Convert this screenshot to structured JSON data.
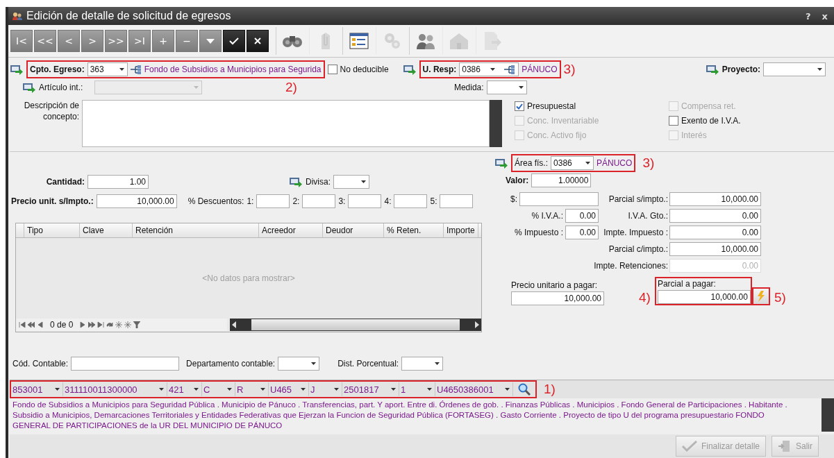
{
  "window": {
    "title": "Edición de detalle de solicitud de egresos",
    "help_button": "?",
    "close_button": "x"
  },
  "toolbar": [
    {
      "kind": "glyph",
      "label": "I<",
      "disabled": false
    },
    {
      "kind": "glyph",
      "label": "<<",
      "disabled": false
    },
    {
      "kind": "glyph",
      "label": "<",
      "disabled": false
    },
    {
      "kind": "glyph",
      "label": ">",
      "disabled": false
    },
    {
      "kind": "glyph",
      "label": ">>",
      "disabled": false
    },
    {
      "kind": "glyph",
      "label": ">I",
      "disabled": false
    },
    {
      "kind": "glyph",
      "label": "+",
      "disabled": false
    },
    {
      "kind": "glyph",
      "label": "−",
      "disabled": false
    },
    {
      "kind": "caret",
      "disabled": false
    },
    {
      "kind": "check",
      "disabled": false
    },
    {
      "kind": "cancel",
      "disabled": false
    },
    {
      "kind": "binoculars",
      "disabled": false
    },
    {
      "kind": "clip",
      "disabled": true
    },
    {
      "kind": "form",
      "disabled": false
    },
    {
      "kind": "gears",
      "disabled": true
    },
    {
      "kind": "people",
      "disabled": false
    },
    {
      "kind": "house",
      "disabled": true
    },
    {
      "kind": "export",
      "disabled": true
    }
  ],
  "cpto_egreso": {
    "label": "Cpto. Egreso:",
    "value": "363",
    "description": "Fondo de Subsidios a Municipios para Segurida",
    "annotation": "2)"
  },
  "no_deducible": {
    "label": "No deducible",
    "checked": false
  },
  "u_resp": {
    "label": "U. Resp:",
    "value": "0386",
    "description": "PÁNUCO",
    "annotation": "3)"
  },
  "proyecto": {
    "label": "Proyecto:"
  },
  "articulo_int": {
    "label": "Artículo int.:",
    "disabled": true
  },
  "medida": {
    "label": "Medida:"
  },
  "descripcion": {
    "label": "Descripción de concepto:"
  },
  "checkboxes": [
    {
      "label": "Presupuestal",
      "checked": true,
      "disabled": false
    },
    {
      "label": "Compensa ret.",
      "checked": false,
      "disabled": true
    },
    {
      "label": "Conc. Inventariable",
      "checked": false,
      "disabled": true
    },
    {
      "label": "Exento de I.V.A.",
      "checked": false,
      "disabled": false
    },
    {
      "label": "Conc. Activo fijo",
      "checked": false,
      "disabled": true
    },
    {
      "label": "Interés",
      "checked": false,
      "disabled": true
    }
  ],
  "cantidad": {
    "label": "Cantidad:",
    "value": "1.00"
  },
  "divisa": {
    "label": "Divisa:"
  },
  "precio_unit": {
    "label": "Precio unit. s/Impto.:",
    "value": "10,000.00"
  },
  "descuentos": {
    "label": "% Descuentos:",
    "fields": [
      "1:",
      "2:",
      "3:",
      "4:",
      "5:"
    ]
  },
  "retenciones_table": {
    "columns": [
      "Tipo",
      "Clave",
      "Retención",
      "Acreedor",
      "Deudor",
      "% Reten.",
      "Importe"
    ],
    "empty_text": "<No datos para mostrar>",
    "pager": "0 de 0"
  },
  "area_fis": {
    "label": "Área fís.:",
    "value": "0386",
    "description": "PÁNUCO",
    "annotation": "3)"
  },
  "valor": {
    "label": "Valor:",
    "value": "1.00000"
  },
  "left_amounts": [
    {
      "label": "$:"
    },
    {
      "label": "% I.V.A.:",
      "value": "0.00"
    },
    {
      "label": "% Impuesto :",
      "value": "0.00"
    }
  ],
  "totals": [
    {
      "label": "Parcial s/impto.:",
      "value": "10,000.00",
      "disabled": false
    },
    {
      "label": "I.V.A. Gto.:",
      "value": "0.00",
      "disabled": false
    },
    {
      "label": "Impte. Impuesto :",
      "value": "0.00",
      "disabled": false
    },
    {
      "label": "Parcial c/impto.:",
      "value": "10,000.00",
      "disabled": false
    },
    {
      "label": "Impte. Retenciones:",
      "value": "0.00",
      "disabled": true
    }
  ],
  "precio_unitario_pagar": {
    "label": "Precio unitario a pagar:",
    "value": "10,000.00"
  },
  "parcial_pagar": {
    "label": "Parcial a pagar:",
    "value": "10,000.00",
    "annotation": "4)",
    "button_annotation": "5)"
  },
  "cod_contable": {
    "label": "Cód. Contable:"
  },
  "departamento": {
    "label": "Departamento contable:"
  },
  "dist_porcentual": {
    "label": "Dist. Porcentual:"
  },
  "clave_presupuestal": {
    "segments": [
      "853001",
      "311110011300000",
      "421",
      "C",
      "R",
      "U465",
      "J",
      "2501817",
      "1",
      "U4650386001"
    ],
    "annotation": "1)"
  },
  "clave_descripcion": "Fondo de Subsidios a Municipios para Seguridad Pública . Municipio de Pánuco . Transferencias, part. Y aport. Entre di. Órdenes de gob. . Finanzas Públicas . Municipios . Fondo General de Participaciones . Habitante . Subsidio a Municipios, Demarcaciones Territoriales y Entidades Federativas que Ejerzan la Funcion de Seguridad Pública (FORTASEG) . Gasto Corriente . Proyecto de tipo U del programa presupuestario FONDO GENERAL DE PARTICIPACIONES de la UR DEL MUNICIPIO DE PÁNUCO",
  "buttons": [
    {
      "kind": "finish",
      "label": "Finalizar detalle",
      "disabled": true
    },
    {
      "kind": "exit",
      "label": "Salir",
      "disabled": true
    }
  ]
}
